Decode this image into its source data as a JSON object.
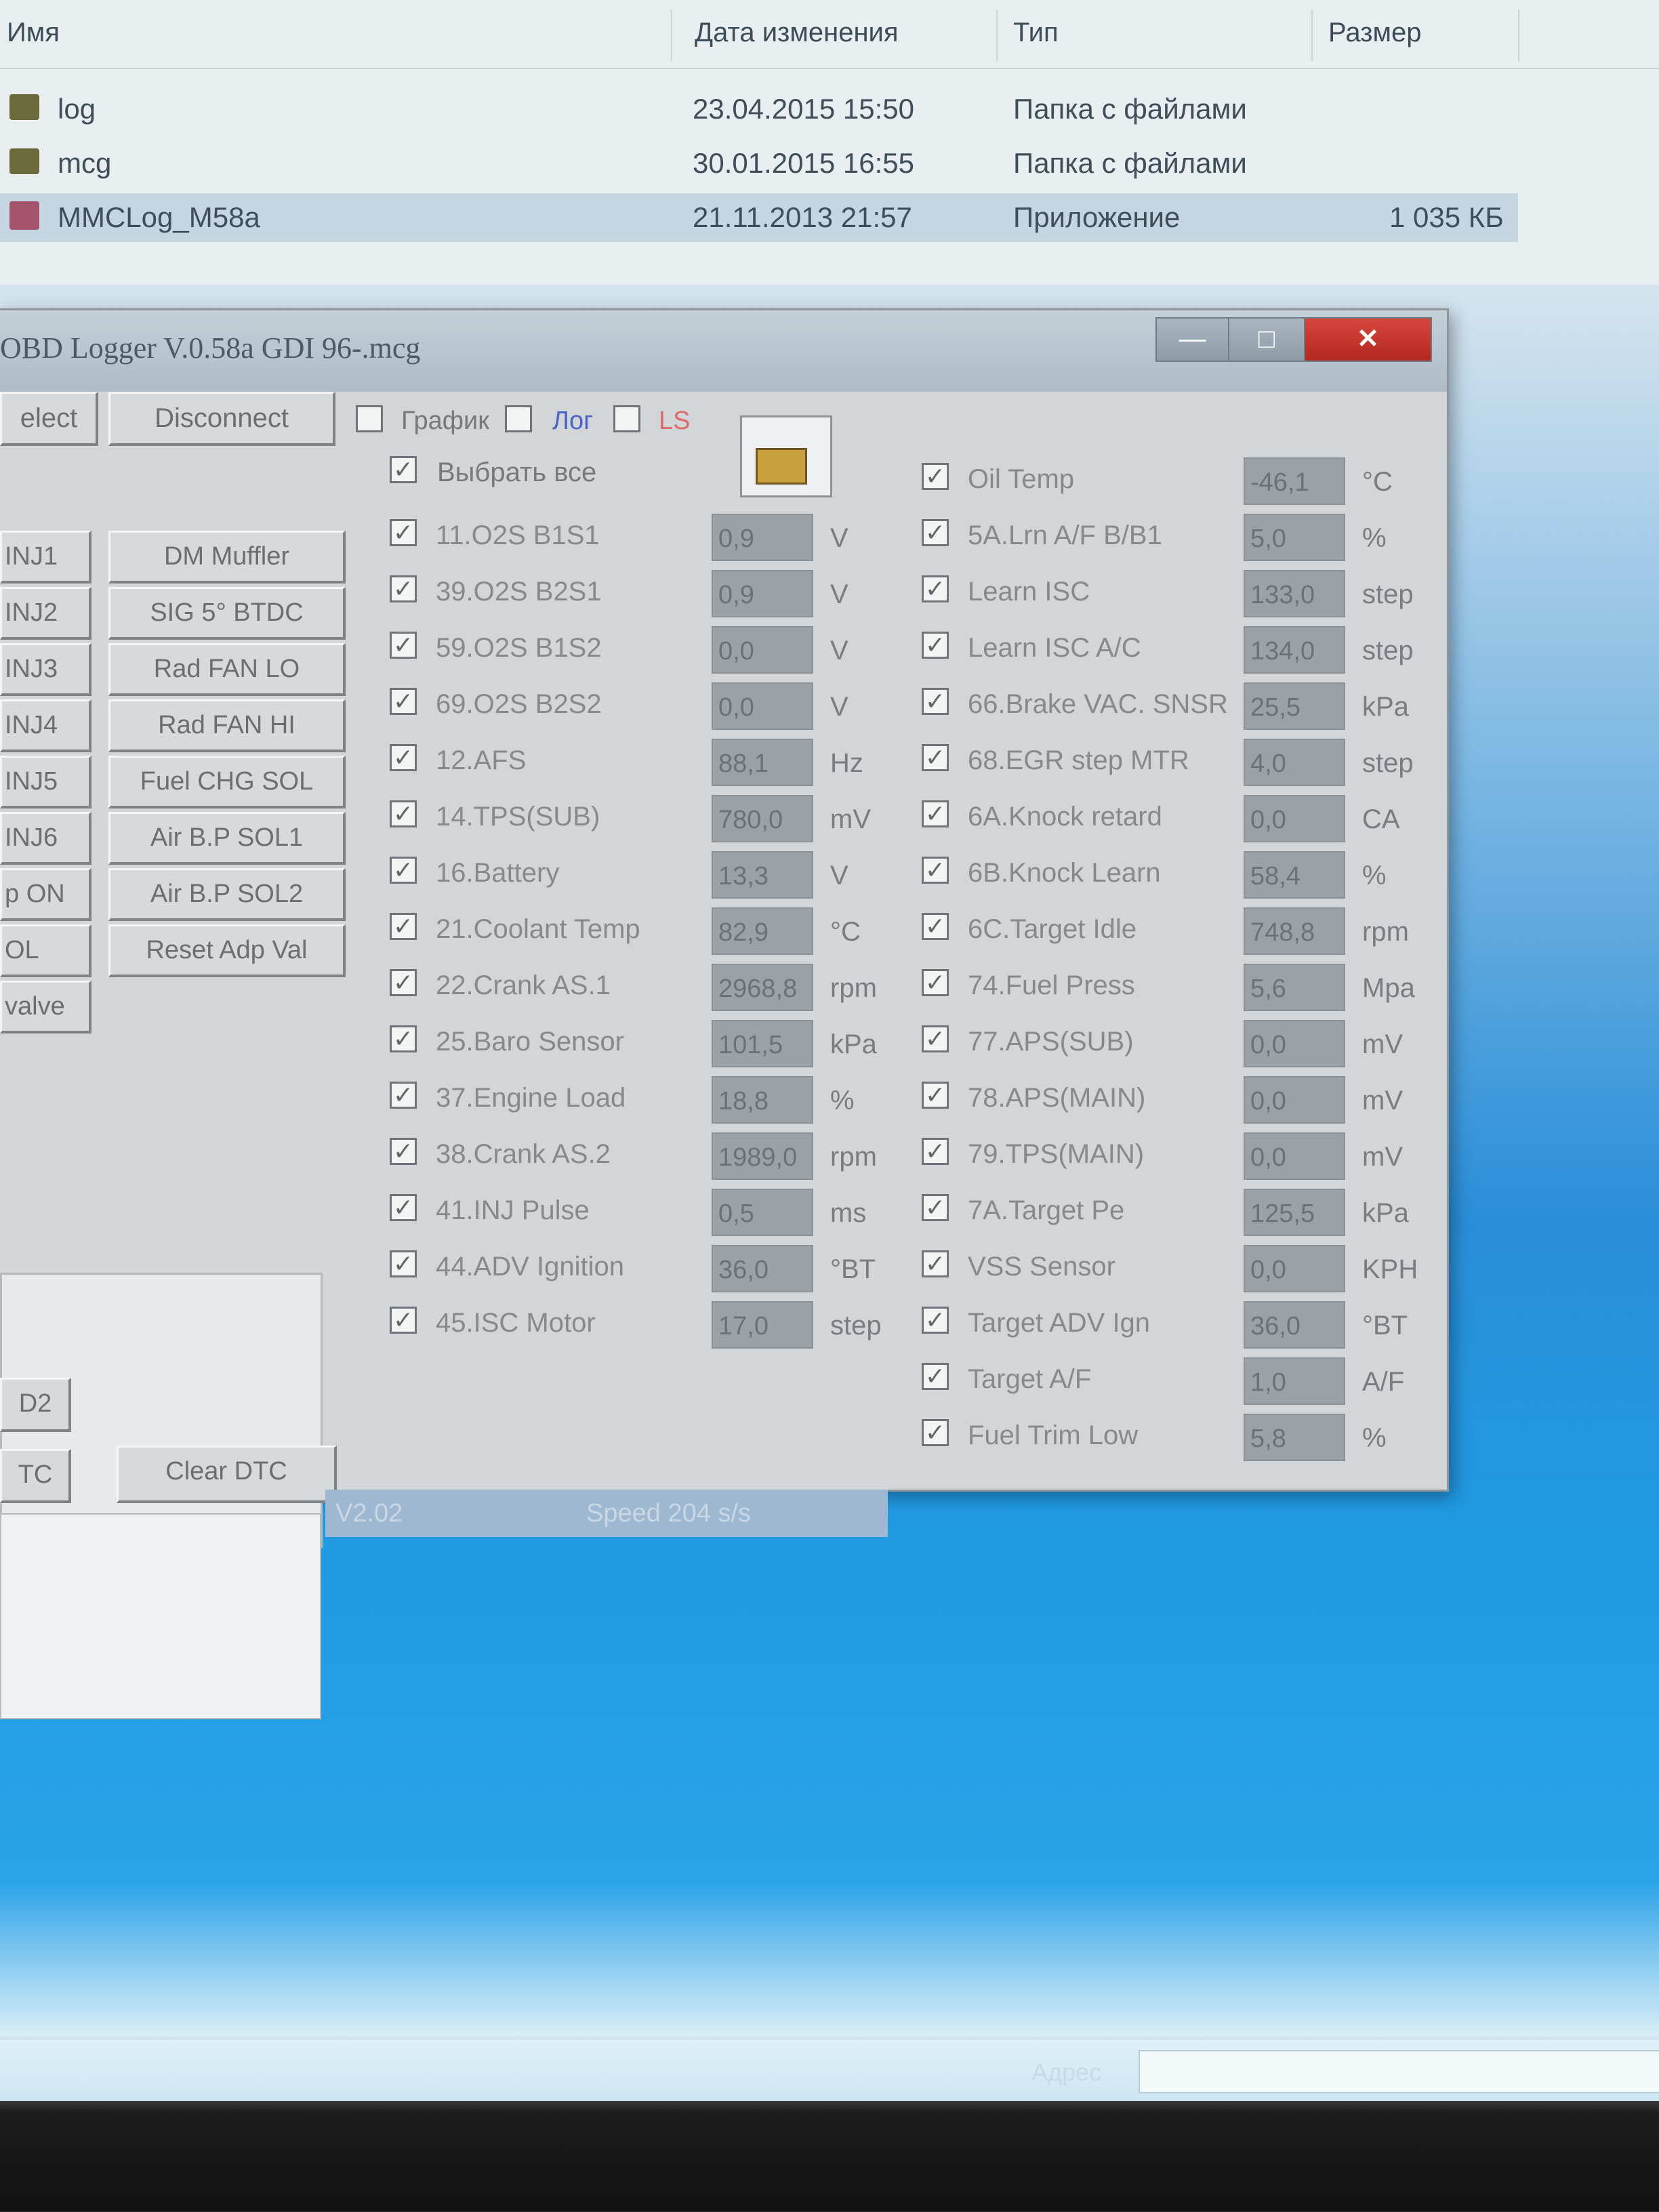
{
  "explorer": {
    "columns": [
      "Имя",
      "Дата изменения",
      "Тип",
      "Размер"
    ],
    "rows": [
      {
        "name": "log",
        "date": "23.04.2015 15:50",
        "type": "Папка с файлами",
        "size": ""
      },
      {
        "name": "mcg",
        "date": "30.01.2015 16:55",
        "type": "Папка с файлами",
        "size": ""
      },
      {
        "name": "MMCLog_M58a",
        "date": "21.11.2013 21:57",
        "type": "Приложение",
        "size": "1 035 КБ"
      }
    ]
  },
  "window": {
    "title": "OBD Logger V.0.58a GDI 96-.mcg",
    "minimize": "—",
    "maximize": "□",
    "close": "✕"
  },
  "toolbar": {
    "select_label": "elect",
    "disconnect_label": "Disconnect",
    "graph_label": "График",
    "log_label": "Лог",
    "red_label": "LS"
  },
  "select_all_label": "Выбрать все",
  "actuators_left": [
    "INJ1",
    "INJ2",
    "INJ3",
    "INJ4",
    "INJ5",
    "INJ6",
    "p ON",
    "OL",
    "valve"
  ],
  "actuators_right": [
    "DM Muffler",
    "SIG 5° BTDC",
    "Rad FAN LO",
    "Rad FAN HI",
    "Fuel CHG SOL",
    "Air B.P SOL1",
    "Air B.P SOL2",
    "Reset Adp Val"
  ],
  "dtc": {
    "read_label": "D2",
    "tc_label": "TC",
    "clear_label": "Clear DTC"
  },
  "status": {
    "version": "V2.02",
    "speed": "Speed 204 s/s"
  },
  "params_left": [
    {
      "label": "11.O2S B1S1",
      "value": "0,9",
      "unit": "V"
    },
    {
      "label": "39.O2S B2S1",
      "value": "0,9",
      "unit": "V"
    },
    {
      "label": "59.O2S B1S2",
      "value": "0,0",
      "unit": "V"
    },
    {
      "label": "69.O2S B2S2",
      "value": "0,0",
      "unit": "V"
    },
    {
      "label": "12.AFS",
      "value": "88,1",
      "unit": "Hz"
    },
    {
      "label": "14.TPS(SUB)",
      "value": "780,0",
      "unit": "mV"
    },
    {
      "label": "16.Battery",
      "value": "13,3",
      "unit": "V"
    },
    {
      "label": "21.Coolant Temp",
      "value": "82,9",
      "unit": "°C"
    },
    {
      "label": "22.Crank AS.1",
      "value": "2968,8",
      "unit": "rpm"
    },
    {
      "label": "25.Baro Sensor",
      "value": "101,5",
      "unit": "kPa"
    },
    {
      "label": "37.Engine Load",
      "value": "18,8",
      "unit": "%"
    },
    {
      "label": "38.Crank AS.2",
      "value": "1989,0",
      "unit": "rpm"
    },
    {
      "label": "41.INJ Pulse",
      "value": "0,5",
      "unit": "ms"
    },
    {
      "label": "44.ADV Ignition",
      "value": "36,0",
      "unit": "°BT"
    },
    {
      "label": "45.ISC Motor",
      "value": "17,0",
      "unit": "step"
    }
  ],
  "params_right": [
    {
      "label": "Oil Temp",
      "value": "-46,1",
      "unit": "°C"
    },
    {
      "label": "5A.Lrn A/F B/B1",
      "value": "5,0",
      "unit": "%"
    },
    {
      "label": "Learn ISC",
      "value": "133,0",
      "unit": "step"
    },
    {
      "label": "Learn ISC A/C",
      "value": "134,0",
      "unit": "step"
    },
    {
      "label": "66.Brake VAC. SNSR",
      "value": "25,5",
      "unit": "kPa"
    },
    {
      "label": "68.EGR step MTR",
      "value": "4,0",
      "unit": "step"
    },
    {
      "label": "6A.Knock retard",
      "value": "0,0",
      "unit": "CA"
    },
    {
      "label": "6B.Knock Learn",
      "value": "58,4",
      "unit": "%"
    },
    {
      "label": "6C.Target Idle",
      "value": "748,8",
      "unit": "rpm"
    },
    {
      "label": "74.Fuel Press",
      "value": "5,6",
      "unit": "Mpa"
    },
    {
      "label": "77.APS(SUB)",
      "value": "0,0",
      "unit": "mV"
    },
    {
      "label": "78.APS(MAIN)",
      "value": "0,0",
      "unit": "mV"
    },
    {
      "label": "79.TPS(MAIN)",
      "value": "0,0",
      "unit": "mV"
    },
    {
      "label": "7A.Target Pe",
      "value": "125,5",
      "unit": "kPa"
    },
    {
      "label": "VSS Sensor",
      "value": "0,0",
      "unit": "KPH"
    },
    {
      "label": "Target ADV Ign",
      "value": "36,0",
      "unit": "°BT"
    },
    {
      "label": "Target A/F",
      "value": "1,0",
      "unit": "A/F"
    },
    {
      "label": "Fuel Trim Low",
      "value": "5,8",
      "unit": "%"
    }
  ],
  "taskbar": {
    "text": "Адрес"
  }
}
